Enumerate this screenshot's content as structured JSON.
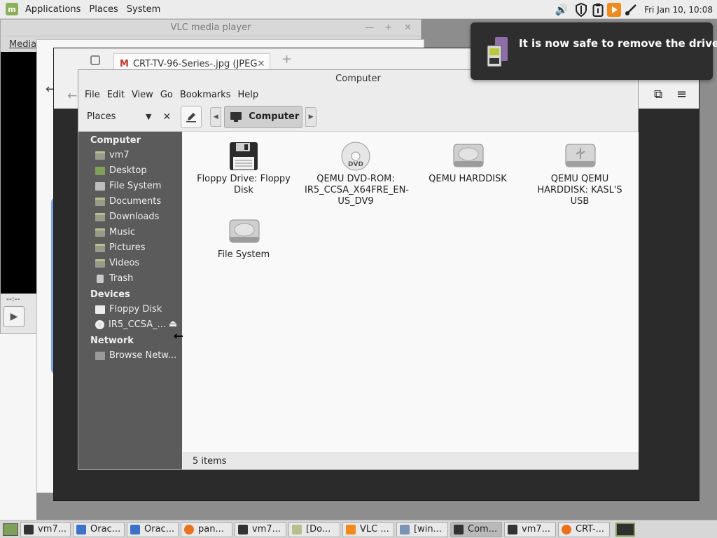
{
  "top_panel": {
    "applications": "Applications",
    "places": "Places",
    "system": "System",
    "clock": "Fri Jan 10, 10:08"
  },
  "vlc": {
    "title": "VLC media player",
    "menu_first": "Media",
    "time": "--:--"
  },
  "viewer": {
    "tab_title": "CRT-TV-96-Series-.jpg (JPEG",
    "new_tab": "+"
  },
  "file_manager": {
    "title": "Computer",
    "menus": [
      "File",
      "Edit",
      "View",
      "Go",
      "Bookmarks",
      "Help"
    ],
    "places_label": "Places",
    "breadcrumb": "Computer",
    "sidebar": {
      "computer_heading": "Computer",
      "computer_items": [
        "vm7",
        "Desktop",
        "File System",
        "Documents",
        "Downloads",
        "Music",
        "Pictures",
        "Videos",
        "Trash"
      ],
      "devices_heading": "Devices",
      "device_items": [
        "Floppy Disk",
        "IR5_CCSA_..."
      ],
      "network_heading": "Network",
      "network_items": [
        "Browse Netw..."
      ]
    },
    "items": [
      {
        "label": "Floppy Drive: Floppy Disk",
        "icon": "floppy-icon"
      },
      {
        "label": "QEMU DVD-ROM: IR5_CCSA_X64FRE_EN-US_DV9",
        "icon": "dvd-icon"
      },
      {
        "label": "QEMU HARDDISK",
        "icon": "harddisk-icon"
      },
      {
        "label": "QEMU QEMU HARDDISK: KASL'S USB",
        "icon": "usb-drive-icon"
      },
      {
        "label": "File System",
        "icon": "harddisk-icon"
      }
    ],
    "status": "5 items"
  },
  "notification": {
    "message": "It is now safe to remove the drive"
  },
  "taskbar": {
    "items": [
      "vm7...",
      "Orac...",
      "Orac...",
      "pan...",
      "vm7...",
      "[Do...",
      "VLC ...",
      "[win...",
      "Com...",
      "vm7...",
      "CRT-..."
    ]
  }
}
